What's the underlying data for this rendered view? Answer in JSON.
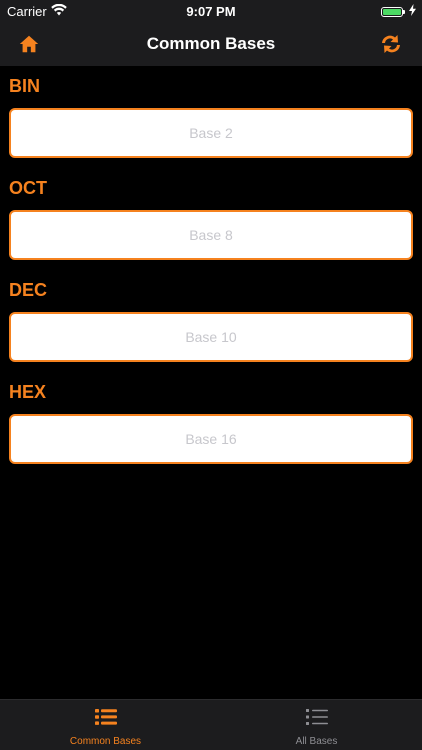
{
  "status_bar": {
    "carrier": "Carrier",
    "time": "9:07 PM",
    "battery_level": 1.0,
    "icons": [
      "wifi-icon",
      "battery-icon",
      "charging-bolt-icon"
    ]
  },
  "nav": {
    "title": "Common Bases",
    "left_icon": "home-icon",
    "right_icon": "swap-arrows-icon"
  },
  "sections": [
    {
      "label": "BIN",
      "placeholder": "Base 2",
      "value": ""
    },
    {
      "label": "OCT",
      "placeholder": "Base 8",
      "value": ""
    },
    {
      "label": "DEC",
      "placeholder": "Base 10",
      "value": ""
    },
    {
      "label": "HEX",
      "placeholder": "Base 16",
      "value": ""
    }
  ],
  "tabs": [
    {
      "label": "Common Bases",
      "icon": "list-icon",
      "active": true
    },
    {
      "label": "All Bases",
      "icon": "list-icon",
      "active": false
    }
  ],
  "colors": {
    "accent": "#f5821f",
    "background": "#000000",
    "bar_background": "#1c1c1e",
    "inactive": "#8e8e93"
  }
}
